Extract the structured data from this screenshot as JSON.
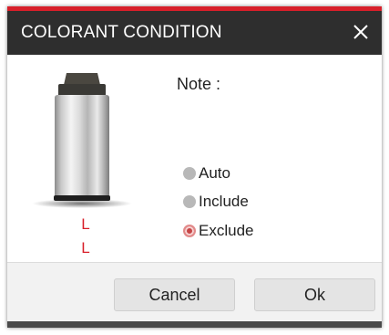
{
  "dialog": {
    "title": "COLORANT CONDITION",
    "accent_color": "#d81f2a",
    "titlebar_color": "#2e2e2e",
    "close_icon": "close-icon"
  },
  "main": {
    "canister_icon": "colorant-canister-icon",
    "codes": [
      "L",
      "L"
    ],
    "code_color": "#d81f2a",
    "note_label": "Note :"
  },
  "condition": {
    "options": [
      {
        "label": "Auto",
        "selected": false
      },
      {
        "label": "Include",
        "selected": false
      },
      {
        "label": "Exclude",
        "selected": true
      }
    ],
    "selected_color": "#c64646"
  },
  "footer": {
    "cancel_label": "Cancel",
    "ok_label": "Ok"
  }
}
